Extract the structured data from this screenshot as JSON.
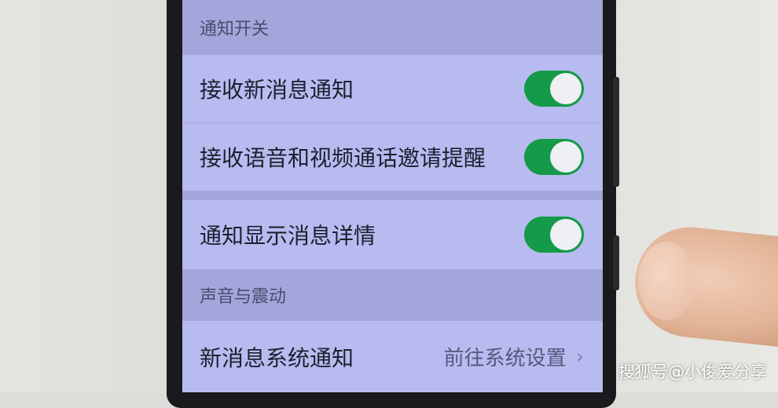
{
  "sections": {
    "notify_header": "通知开关",
    "sound_header": "声音与震动"
  },
  "settings": {
    "receive_new_msg": {
      "label": "接收新消息通知",
      "enabled": true
    },
    "voice_video_invite": {
      "label": "接收语音和视频通话邀请提醒",
      "enabled": true
    },
    "show_details": {
      "label": "通知显示消息详情",
      "enabled": true
    },
    "new_msg_system": {
      "label": "新消息系统通知",
      "value": "前往系统设置"
    }
  },
  "watermark": "搜狐号@小俊爱分享",
  "colors": {
    "toggle_on": "#149a48",
    "row_bg": "#b7bbf0",
    "section_bg": "#a2a6da"
  }
}
